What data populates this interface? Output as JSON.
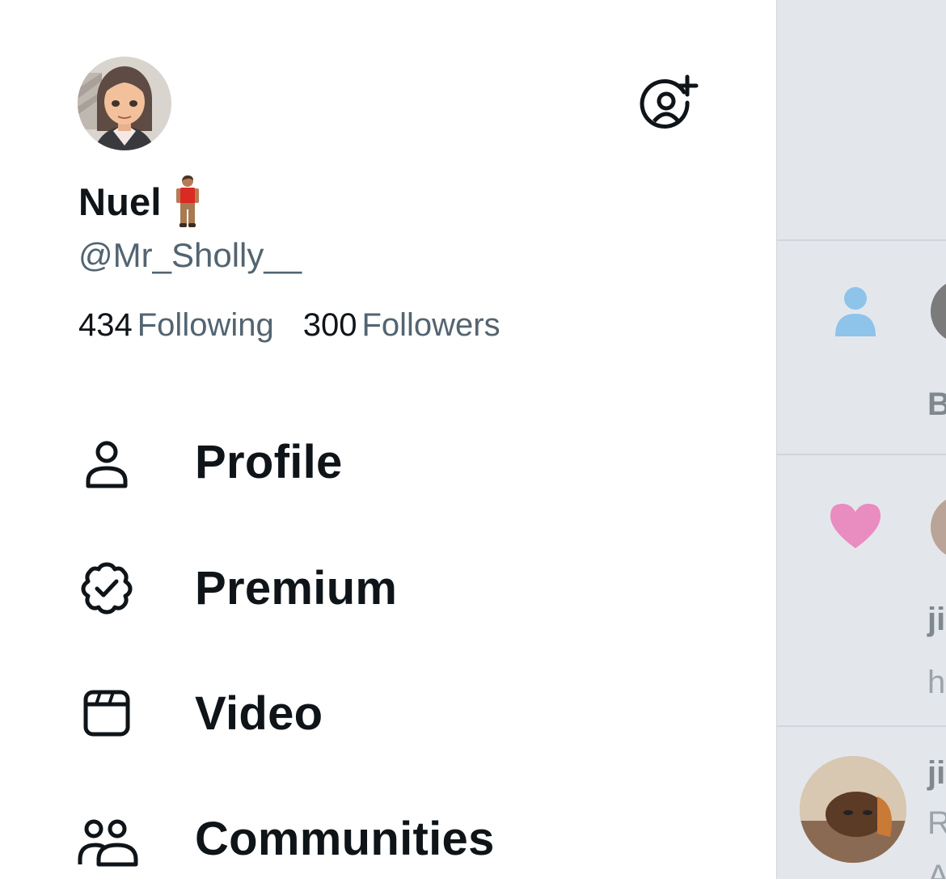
{
  "profile": {
    "display_name": "Nuel",
    "name_emoji": "man-standing-emoji",
    "handle": "@Mr_Sholly__",
    "following_count": "434",
    "following_label": "Following",
    "followers_count": "300",
    "followers_label": "Followers"
  },
  "menu": [
    {
      "label": "Profile",
      "icon": "person-icon"
    },
    {
      "label": "Premium",
      "icon": "verified-badge-icon"
    },
    {
      "label": "Video",
      "icon": "video-clapper-icon"
    },
    {
      "label": "Communities",
      "icon": "communities-icon"
    }
  ],
  "background_timeline": {
    "row1_text": "B",
    "row2_name": "ji",
    "row2_text": "h",
    "row3_name": "ji",
    "row3_text": "R",
    "row3_extra": "A"
  },
  "colors": {
    "text_primary": "#0f1419",
    "text_secondary": "#536471",
    "backdrop": "#e3e7eb",
    "notif_person": "#8ec3ea",
    "notif_heart": "#e98cbf"
  }
}
